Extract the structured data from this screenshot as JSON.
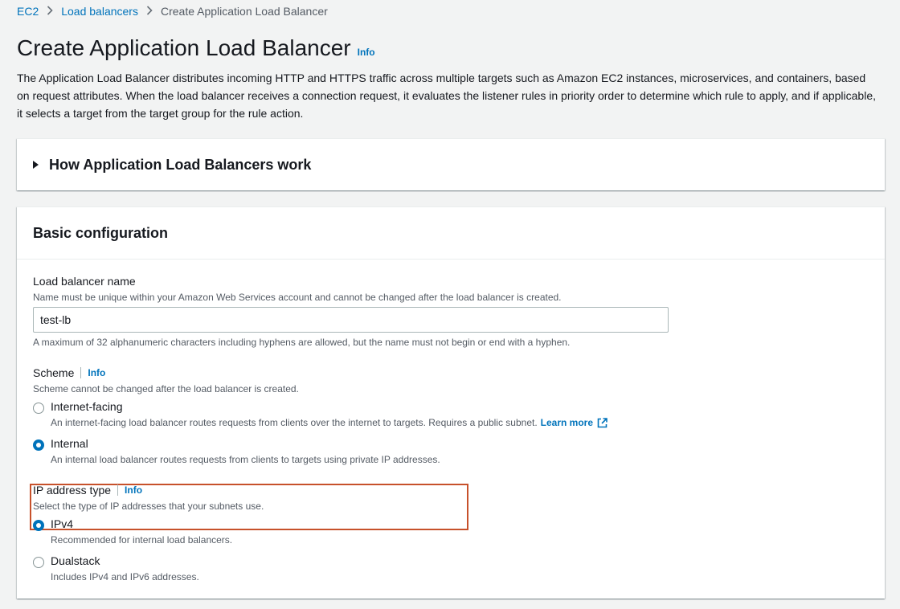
{
  "breadcrumb": {
    "items": [
      "EC2",
      "Load balancers"
    ],
    "current": "Create Application Load Balancer"
  },
  "page": {
    "title": "Create Application Load Balancer",
    "info": "Info",
    "description": "The Application Load Balancer distributes incoming HTTP and HTTPS traffic across multiple targets such as Amazon EC2 instances, microservices, and containers, based on request attributes. When the load balancer receives a connection request, it evaluates the listener rules in priority order to determine which rule to apply, and if applicable, it selects a target from the target group for the rule action."
  },
  "how_it_works": {
    "title": "How Application Load Balancers work"
  },
  "basic_config": {
    "title": "Basic configuration",
    "name": {
      "label": "Load balancer name",
      "description": "Name must be unique within your Amazon Web Services account and cannot be changed after the load balancer is created.",
      "value": "test-lb",
      "constraint": "A maximum of 32 alphanumeric characters including hyphens are allowed, but the name must not begin or end with a hyphen."
    },
    "scheme": {
      "label": "Scheme",
      "info": "Info",
      "description": "Scheme cannot be changed after the load balancer is created.",
      "options": [
        {
          "label": "Internet-facing",
          "description": "An internet-facing load balancer routes requests from clients over the internet to targets. Requires a public subnet.",
          "link": "Learn more",
          "selected": false
        },
        {
          "label": "Internal",
          "description": "An internal load balancer routes requests from clients to targets using private IP addresses.",
          "selected": true
        }
      ]
    },
    "ip_type": {
      "label": "IP address type",
      "info": "Info",
      "description": "Select the type of IP addresses that your subnets use.",
      "options": [
        {
          "label": "IPv4",
          "description": "Recommended for internal load balancers.",
          "selected": true
        },
        {
          "label": "Dualstack",
          "description": "Includes IPv4 and IPv6 addresses.",
          "selected": false
        }
      ]
    }
  },
  "colors": {
    "link": "#0073bb",
    "highlight": "#c7512b",
    "background": "#f2f3f3"
  }
}
